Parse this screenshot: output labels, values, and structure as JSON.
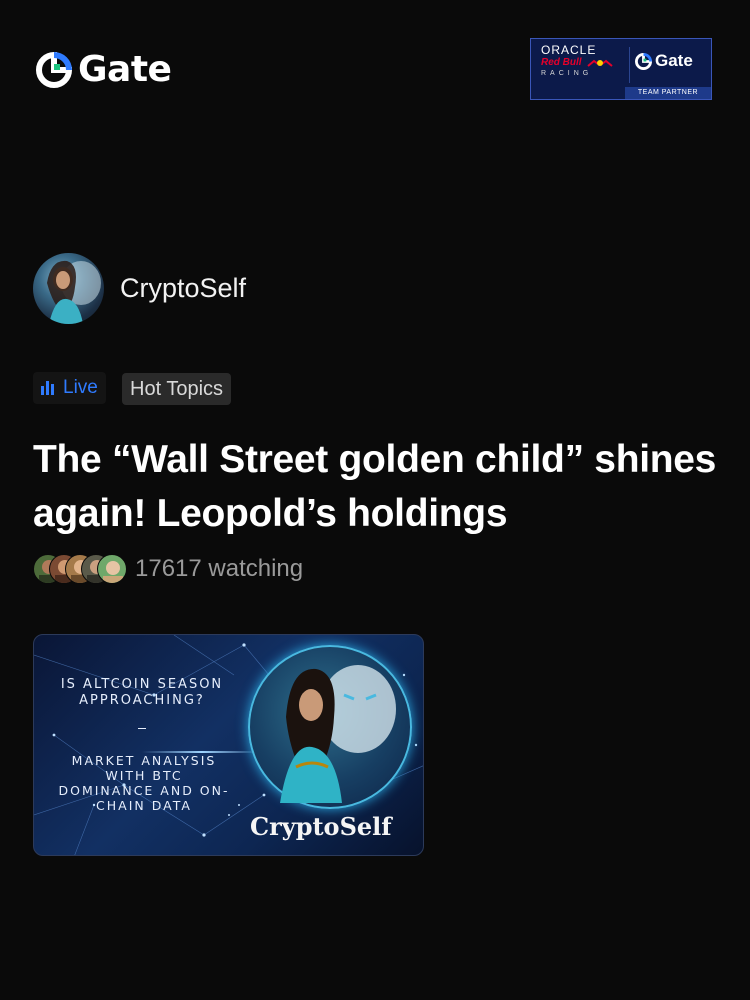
{
  "header": {
    "logo_text": "Gate",
    "partner": {
      "oracle": "ORACLE",
      "redbull": "Red Bull",
      "racing": "RACING",
      "gate_text": "Gate",
      "team_partner": "TEAM PARTNER"
    }
  },
  "author": {
    "name": "CryptoSelf"
  },
  "tags": {
    "live": "Live",
    "topic": "Hot Topics"
  },
  "post": {
    "title": "The “Wall Street golden child” shines again! Leopold’s holdings",
    "watching": "17617 watching"
  },
  "card": {
    "question": "IS ALTCOIN SEASON APPROACHING?",
    "analysis": "MARKET ANALYSIS WITH BTC DOMINANCE AND ON-CHAIN DATA",
    "brand": "CryptoSelf"
  },
  "colors": {
    "accent": "#2f7bff",
    "background": "#0a0a0a",
    "partner_bg": "#0c1a4a"
  }
}
